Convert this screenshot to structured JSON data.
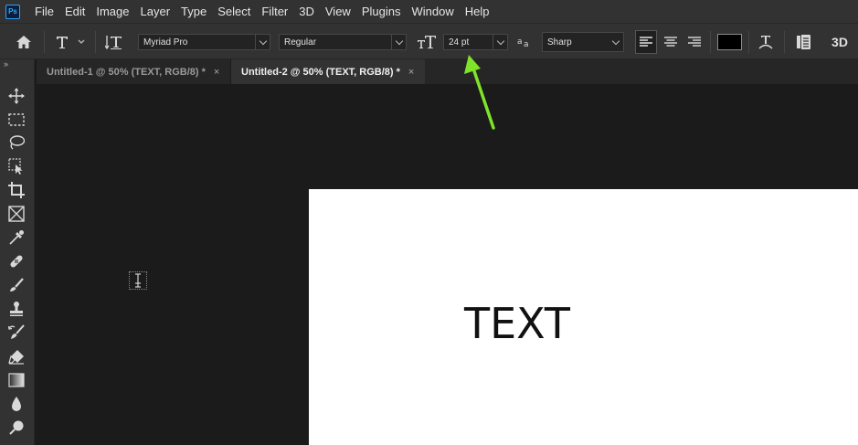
{
  "app": {
    "logo_text": "Ps",
    "accent_color": "#31a8ff"
  },
  "menu": {
    "items": [
      "File",
      "Edit",
      "Image",
      "Layer",
      "Type",
      "Select",
      "Filter",
      "3D",
      "View",
      "Plugins",
      "Window",
      "Help"
    ]
  },
  "options": {
    "font_family": "Myriad Pro",
    "font_style": "Regular",
    "font_size": "24 pt",
    "anti_alias": "Sharp",
    "text_color": "#000000",
    "three_d_label": "3D",
    "icons": [
      "home-icon",
      "type-tool-icon",
      "orientation-icon",
      "font-size-icon",
      "anti-alias-icon",
      "align-left-icon",
      "align-center-icon",
      "align-right-icon",
      "warp-text-icon",
      "character-panel-icon"
    ]
  },
  "tabs": [
    {
      "label": "Untitled-1 @ 50% (TEXT, RGB/8) *",
      "close": "×",
      "active": false
    },
    {
      "label": "Untitled-2 @ 50% (TEXT, RGB/8) *",
      "close": "×",
      "active": true
    }
  ],
  "toolbar": {
    "collapse": "››",
    "tools": [
      "move-tool-icon",
      "marquee-tool-icon",
      "lasso-tool-icon",
      "object-select-tool-icon",
      "crop-tool-icon",
      "frame-tool-icon",
      "eyedropper-tool-icon",
      "healing-brush-tool-icon",
      "brush-tool-icon",
      "clone-stamp-tool-icon",
      "history-brush-tool-icon",
      "eraser-tool-icon",
      "gradient-tool-icon",
      "blur-tool-icon",
      "dodge-tool-icon"
    ]
  },
  "canvas": {
    "text": "TEXT"
  },
  "annotation": {
    "arrow_color": "#7fe32a"
  }
}
